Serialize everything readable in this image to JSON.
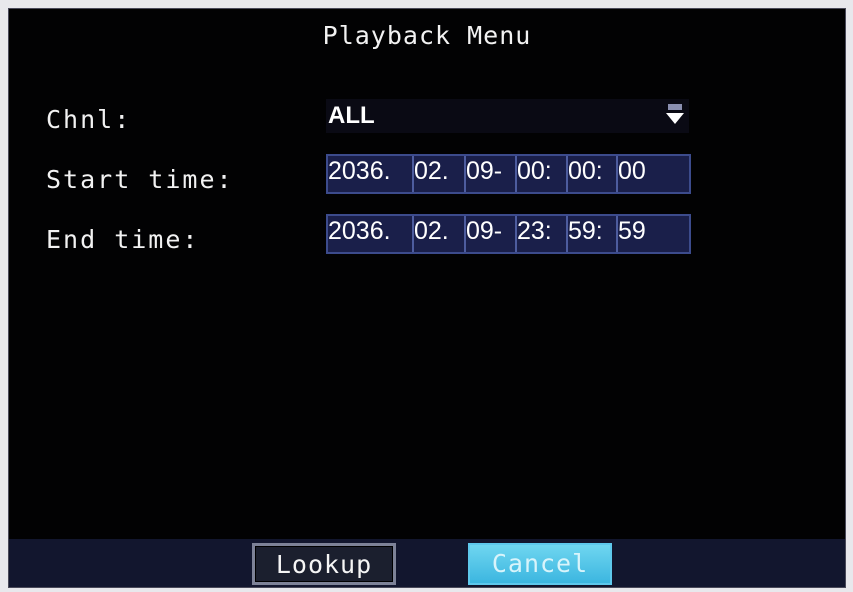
{
  "title": "Playback Menu",
  "channel": {
    "label": "Chnl:",
    "value": "ALL",
    "icon": "dropdown-arrow-icon"
  },
  "start_time": {
    "label": "Start time:",
    "segments": [
      "2036.",
      "02.",
      "09-",
      "00:",
      "00:",
      "00"
    ]
  },
  "end_time": {
    "label": "End time:",
    "segments": [
      "2036.",
      "02.",
      "09-",
      "23:",
      "59:",
      "59"
    ]
  },
  "buttons": {
    "lookup": "Lookup",
    "cancel": "Cancel"
  },
  "colors": {
    "background": "#020203",
    "field": "#1a1f4a",
    "highlight": "#3cb6e0",
    "text": "#ffffff"
  }
}
